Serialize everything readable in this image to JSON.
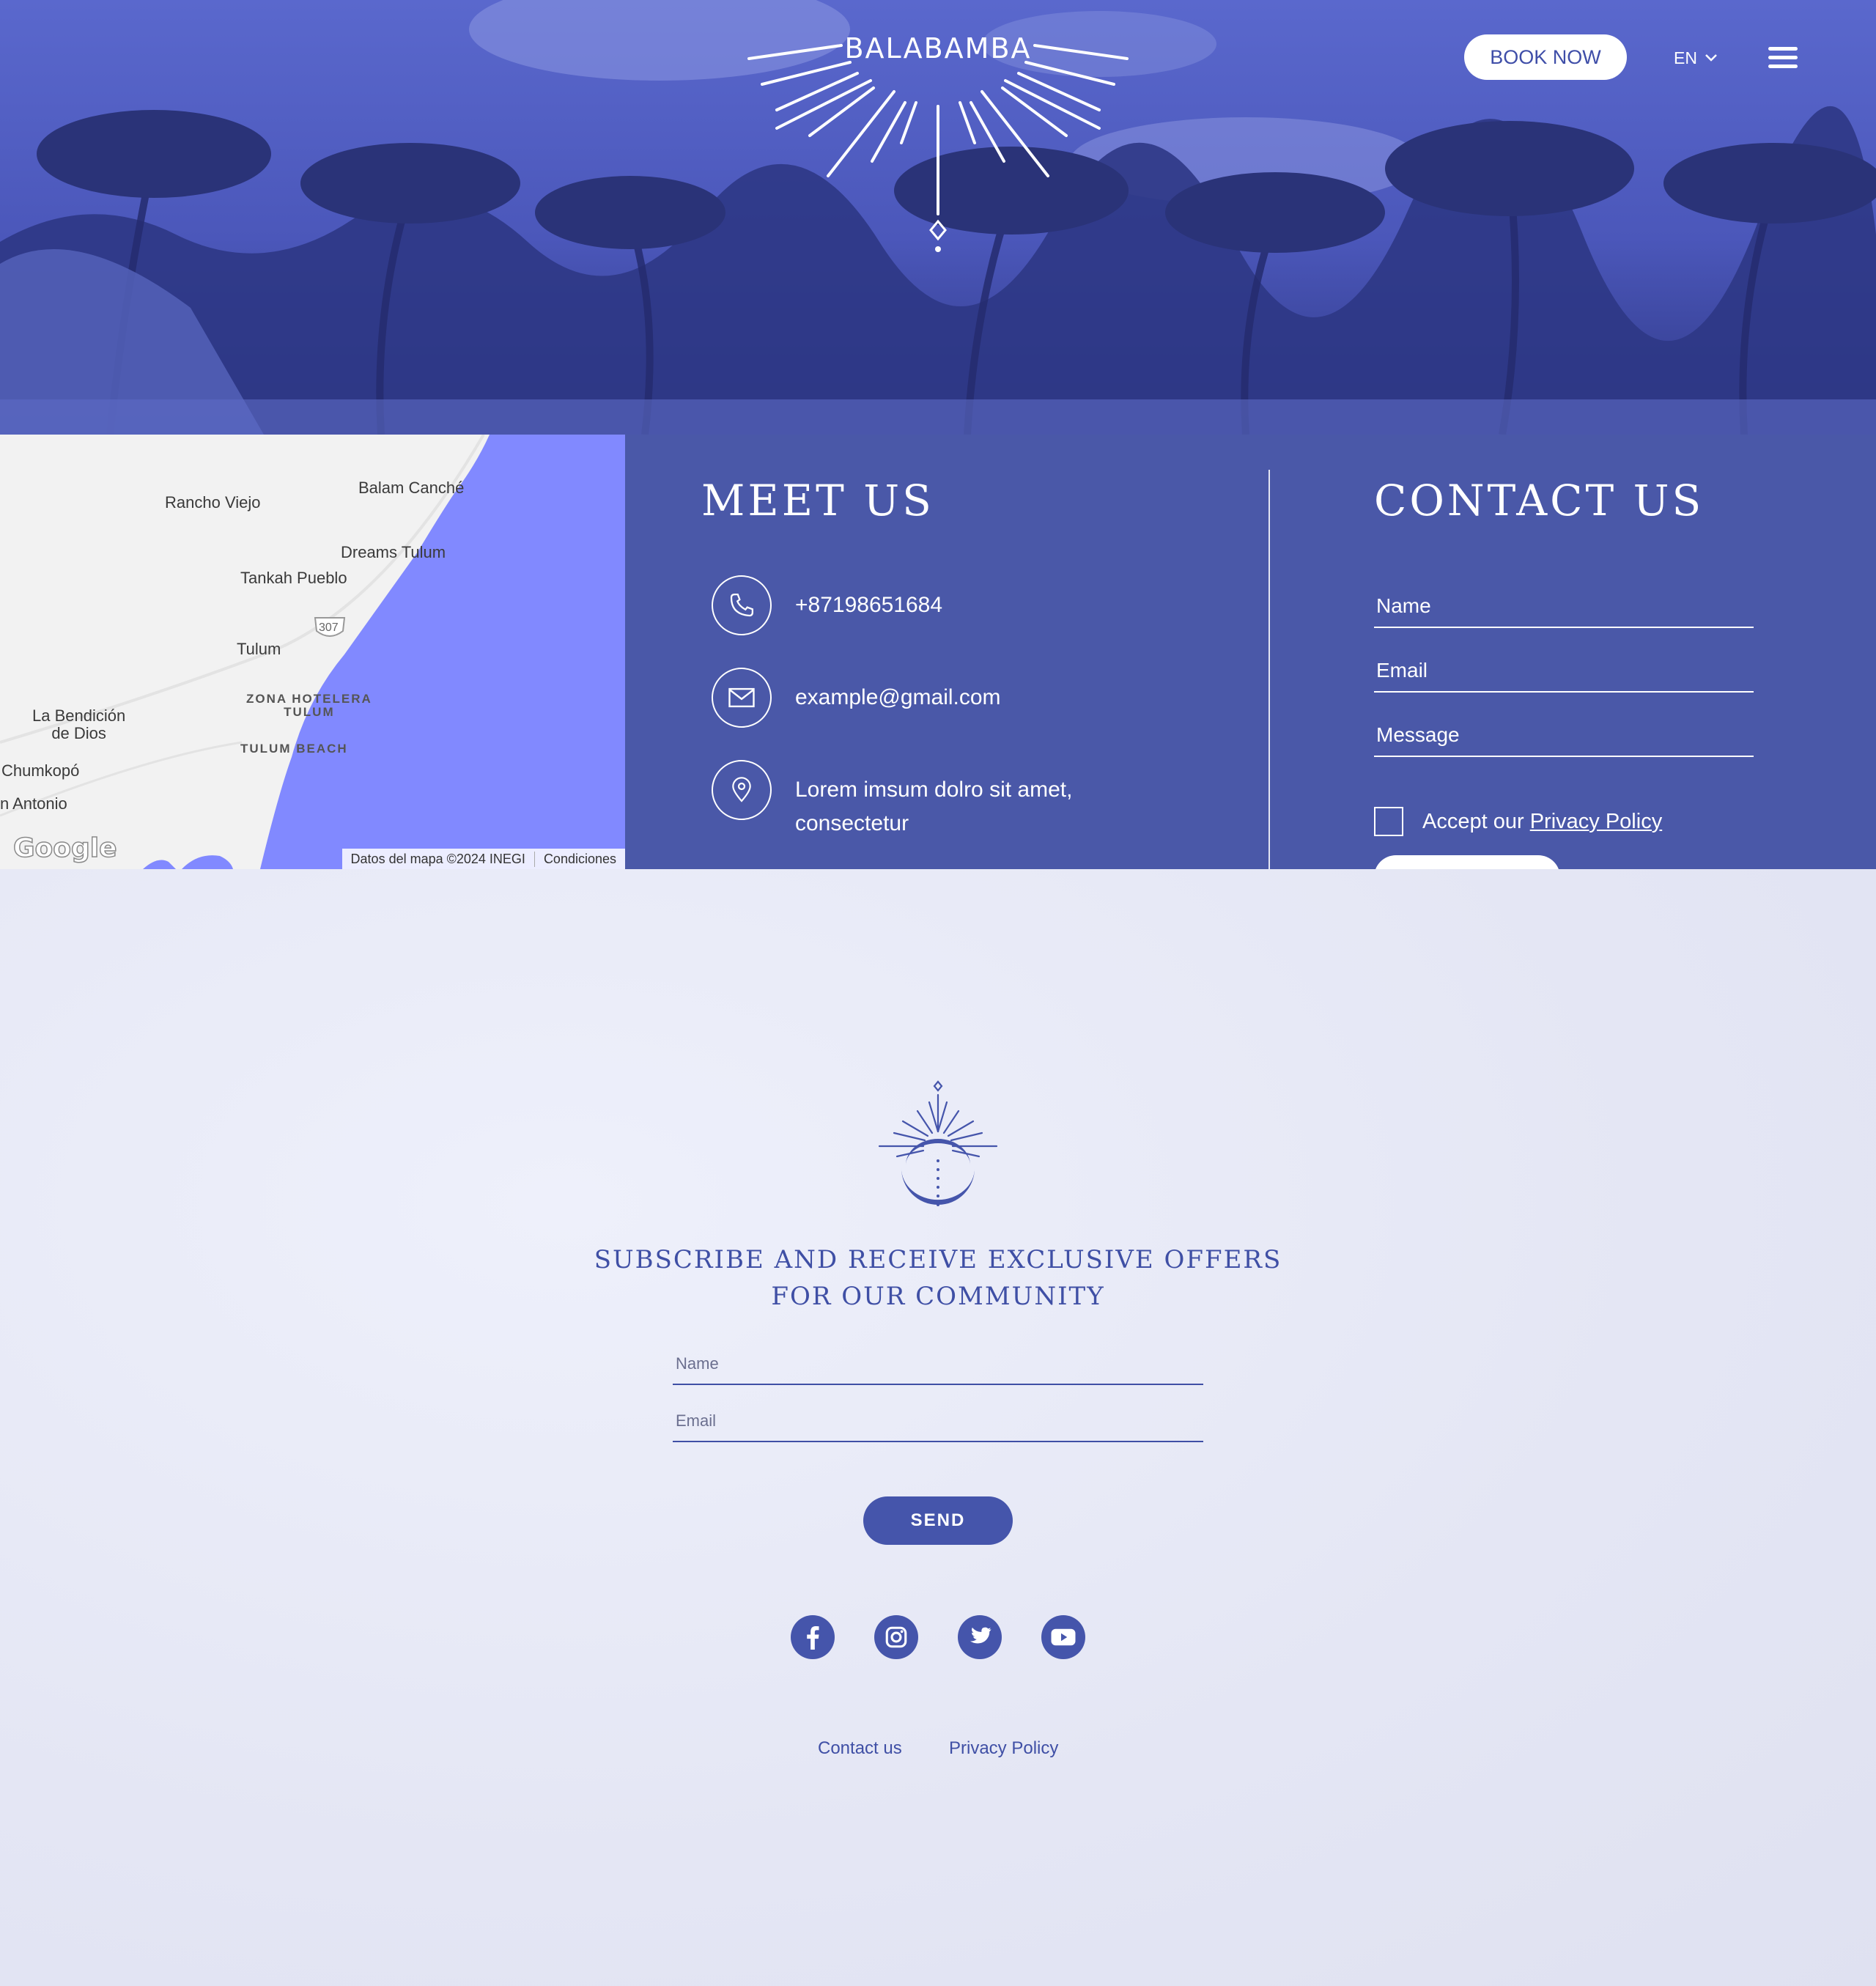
{
  "header": {
    "logo_text": "BALABAMBA",
    "book_now_label": "BOOK NOW",
    "language": "EN"
  },
  "map": {
    "places": [
      "Rancho Viejo",
      "Balam Canché",
      "Dreams Tulum",
      "Tankah Pueblo",
      "307",
      "Tulum",
      "ZONA HOTELERA",
      "TULUM",
      "TULUM BEACH",
      "La Bendición",
      "de Dios",
      "Chumkopó",
      "n Antonio"
    ],
    "google_logo": "Google",
    "attribution": "Datos del mapa ©2024 INEGI",
    "terms": "Condiciones"
  },
  "meet": {
    "title": "MEET US",
    "phone": "+87198651684",
    "email": "example@gmail.com",
    "address_line1": "Lorem imsum dolro sit amet,",
    "address_line2": "consectetur"
  },
  "contact": {
    "title": "CONTACT US",
    "name_placeholder": "Name",
    "email_placeholder": "Email",
    "message_placeholder": "Message",
    "accept_text": "Accept our",
    "privacy_link": "Privacy Policy"
  },
  "subscribe": {
    "title_line1": "SUBSCRIBE AND RECEIVE EXCLUSIVE OFFERS",
    "title_line2": "FOR OUR COMMUNITY",
    "name_placeholder": "Name",
    "email_placeholder": "Email",
    "send_label": "SEND"
  },
  "social": [
    "facebook-icon",
    "instagram-icon",
    "twitter-icon",
    "youtube-icon"
  ],
  "footer": {
    "contact_link": "Contact us",
    "privacy_link": "Privacy Policy"
  },
  "colors": {
    "brand_blue": "#4a58a8",
    "sea_blue": "#8189ff",
    "accent_text": "#3f4fa5"
  }
}
